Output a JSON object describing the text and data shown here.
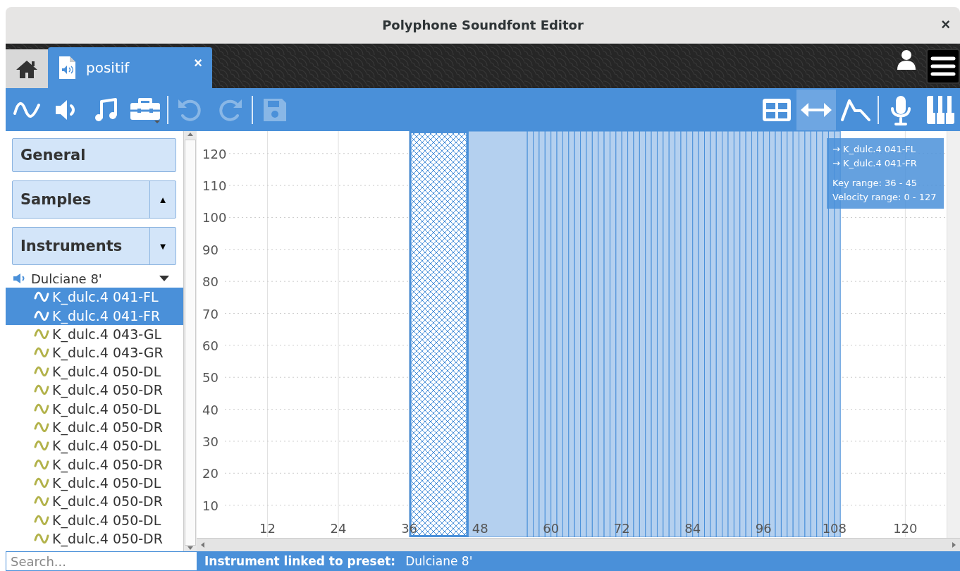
{
  "window": {
    "title": "Polyphone Soundfont Editor",
    "close": "×"
  },
  "tabs": [
    {
      "kind": "home",
      "selected": false
    },
    {
      "kind": "file",
      "label": "positif",
      "close": "×",
      "selected": true
    }
  ],
  "toolbar": {
    "left": [
      {
        "kind": "wave",
        "disabled": false
      },
      {
        "kind": "speaker",
        "disabled": false
      },
      {
        "kind": "note",
        "disabled": false
      },
      {
        "kind": "toolbox",
        "disabled": false
      },
      {
        "kind": "separator"
      },
      {
        "kind": "undo",
        "disabled": true
      },
      {
        "kind": "redo",
        "disabled": true
      },
      {
        "kind": "separator"
      },
      {
        "kind": "save",
        "disabled": true
      }
    ],
    "right": [
      {
        "kind": "table",
        "selected": false
      },
      {
        "kind": "range",
        "selected": true
      },
      {
        "kind": "envelope",
        "selected": false
      },
      {
        "kind": "separator"
      },
      {
        "kind": "mic",
        "selected": false
      },
      {
        "kind": "piano",
        "selected": false
      }
    ]
  },
  "sidebar": {
    "sections": [
      {
        "label": "General"
      },
      {
        "label": "Samples",
        "arrow": "▲"
      },
      {
        "label": "Instruments",
        "arrow": "▼"
      }
    ],
    "tree": {
      "label": "Dulciane 8'",
      "expanded": true,
      "children": [
        {
          "label": "K_dulc.4 041-FL",
          "selected": true
        },
        {
          "label": "K_dulc.4 041-FR",
          "selected": true
        },
        {
          "label": "K_dulc.4 043-GL",
          "selected": false
        },
        {
          "label": "K_dulc.4 043-GR",
          "selected": false
        },
        {
          "label": "K_dulc.4 050-DL",
          "selected": false
        },
        {
          "label": "K_dulc.4 050-DR",
          "selected": false
        },
        {
          "label": "K_dulc.4 050-DL",
          "selected": false
        },
        {
          "label": "K_dulc.4 050-DR",
          "selected": false
        },
        {
          "label": "K_dulc.4 050-DL",
          "selected": false
        },
        {
          "label": "K_dulc.4 050-DR",
          "selected": false
        },
        {
          "label": "K_dulc.4 050-DL",
          "selected": false
        },
        {
          "label": "K_dulc.4 050-DR",
          "selected": false
        },
        {
          "label": "K_dulc.4 050-DL",
          "selected": false
        },
        {
          "label": "K_dulc.4 050-DR",
          "selected": false
        }
      ]
    },
    "search": {
      "placeholder": "Search..."
    }
  },
  "editor": {
    "chart_data": {
      "type": "scatter",
      "grid": true,
      "xlim": [
        0,
        127
      ],
      "ylim": [
        0,
        127
      ],
      "xticks": [
        12,
        24,
        36,
        48,
        60,
        72,
        84,
        96,
        108,
        120
      ],
      "yticks": [
        10,
        20,
        30,
        40,
        50,
        60,
        70,
        80,
        90,
        100,
        110,
        120
      ],
      "bands": [
        {
          "axis": "x",
          "from": 36,
          "to": 46
        },
        {
          "axis": "x",
          "from": 46,
          "to": 56
        },
        {
          "axis": "x",
          "from": 56,
          "to": 57
        },
        {
          "axis": "x",
          "from": 57,
          "to": 58
        },
        {
          "axis": "x",
          "from": 58,
          "to": 59
        },
        {
          "axis": "x",
          "from": 59,
          "to": 60
        },
        {
          "axis": "x",
          "from": 60,
          "to": 61
        },
        {
          "axis": "x",
          "from": 61,
          "to": 62
        },
        {
          "axis": "x",
          "from": 62,
          "to": 63
        },
        {
          "axis": "x",
          "from": 63,
          "to": 64
        },
        {
          "axis": "x",
          "from": 64,
          "to": 65
        },
        {
          "axis": "x",
          "from": 65,
          "to": 66
        },
        {
          "axis": "x",
          "from": 66,
          "to": 67
        },
        {
          "axis": "x",
          "from": 67,
          "to": 68
        },
        {
          "axis": "x",
          "from": 68,
          "to": 69
        },
        {
          "axis": "x",
          "from": 69,
          "to": 70
        },
        {
          "axis": "x",
          "from": 70,
          "to": 71
        },
        {
          "axis": "x",
          "from": 71,
          "to": 72
        },
        {
          "axis": "x",
          "from": 72,
          "to": 73
        },
        {
          "axis": "x",
          "from": 73,
          "to": 74
        },
        {
          "axis": "x",
          "from": 74,
          "to": 75
        },
        {
          "axis": "x",
          "from": 75,
          "to": 76
        },
        {
          "axis": "x",
          "from": 76,
          "to": 77
        },
        {
          "axis": "x",
          "from": 77,
          "to": 78
        },
        {
          "axis": "x",
          "from": 78,
          "to": 79
        },
        {
          "axis": "x",
          "from": 79,
          "to": 80
        },
        {
          "axis": "x",
          "from": 80,
          "to": 81
        },
        {
          "axis": "x",
          "from": 81,
          "to": 82
        },
        {
          "axis": "x",
          "from": 82,
          "to": 83
        },
        {
          "axis": "x",
          "from": 83,
          "to": 84
        },
        {
          "axis": "x",
          "from": 84,
          "to": 85
        },
        {
          "axis": "x",
          "from": 85,
          "to": 86
        },
        {
          "axis": "x",
          "from": 86,
          "to": 87
        },
        {
          "axis": "x",
          "from": 87,
          "to": 88
        },
        {
          "axis": "x",
          "from": 88,
          "to": 89
        },
        {
          "axis": "x",
          "from": 89,
          "to": 90
        },
        {
          "axis": "x",
          "from": 90,
          "to": 91
        },
        {
          "axis": "x",
          "from": 91,
          "to": 92
        },
        {
          "axis": "x",
          "from": 92,
          "to": 93
        },
        {
          "axis": "x",
          "from": 93,
          "to": 94
        },
        {
          "axis": "x",
          "from": 94,
          "to": 95
        },
        {
          "axis": "x",
          "from": 95,
          "to": 96
        },
        {
          "axis": "x",
          "from": 96,
          "to": 97
        },
        {
          "axis": "x",
          "from": 97,
          "to": 98
        },
        {
          "axis": "x",
          "from": 98,
          "to": 99
        },
        {
          "axis": "x",
          "from": 99,
          "to": 100
        },
        {
          "axis": "x",
          "from": 100,
          "to": 101
        },
        {
          "axis": "x",
          "from": 101,
          "to": 102
        },
        {
          "axis": "x",
          "from": 102,
          "to": 103
        },
        {
          "axis": "x",
          "from": 103,
          "to": 104
        },
        {
          "axis": "x",
          "from": 104,
          "to": 105
        },
        {
          "axis": "x",
          "from": 105,
          "to": 106
        },
        {
          "axis": "x",
          "from": 106,
          "to": 107
        },
        {
          "axis": "x",
          "from": 107,
          "to": 108
        },
        {
          "axis": "x",
          "from": 108,
          "to": 109
        }
      ]
    },
    "zones": [
      {
        "selected": true
      },
      {
        "selected": false
      },
      {
        "selected": false
      },
      {
        "selected": false
      },
      {
        "selected": false
      },
      {
        "selected": false
      },
      {
        "selected": false
      },
      {
        "selected": false
      },
      {
        "selected": false
      },
      {
        "selected": false
      },
      {
        "selected": false
      },
      {
        "selected": false
      },
      {
        "selected": false
      },
      {
        "selected": false
      },
      {
        "selected": false
      },
      {
        "selected": false
      },
      {
        "selected": false
      },
      {
        "selected": false
      },
      {
        "selected": false
      },
      {
        "selected": false
      },
      {
        "selected": false
      },
      {
        "selected": false
      },
      {
        "selected": false
      },
      {
        "selected": false
      },
      {
        "selected": false
      },
      {
        "selected": false
      },
      {
        "selected": false
      },
      {
        "selected": false
      },
      {
        "selected": false
      },
      {
        "selected": false
      },
      {
        "selected": false
      },
      {
        "selected": false
      },
      {
        "selected": false
      },
      {
        "selected": false
      },
      {
        "selected": false
      },
      {
        "selected": false
      },
      {
        "selected": false
      },
      {
        "selected": false
      },
      {
        "selected": false
      },
      {
        "selected": false
      },
      {
        "selected": false
      },
      {
        "selected": false
      },
      {
        "selected": false
      },
      {
        "selected": false
      },
      {
        "selected": false
      },
      {
        "selected": false
      },
      {
        "selected": false
      },
      {
        "selected": false
      },
      {
        "selected": false
      },
      {
        "selected": false
      },
      {
        "selected": false
      },
      {
        "selected": false
      },
      {
        "selected": false
      },
      {
        "selected": false
      },
      {
        "selected": false
      }
    ],
    "tooltip": {
      "links": [
        "→ K_dulc.4 041-FL",
        "→ K_dulc.4 041-FR"
      ],
      "lines": [
        "Key range: 36 - 45",
        "Velocity range: 0 - 127"
      ]
    }
  },
  "status": {
    "label": "Instrument linked to preset:",
    "value": "Dulciane 8'"
  }
}
